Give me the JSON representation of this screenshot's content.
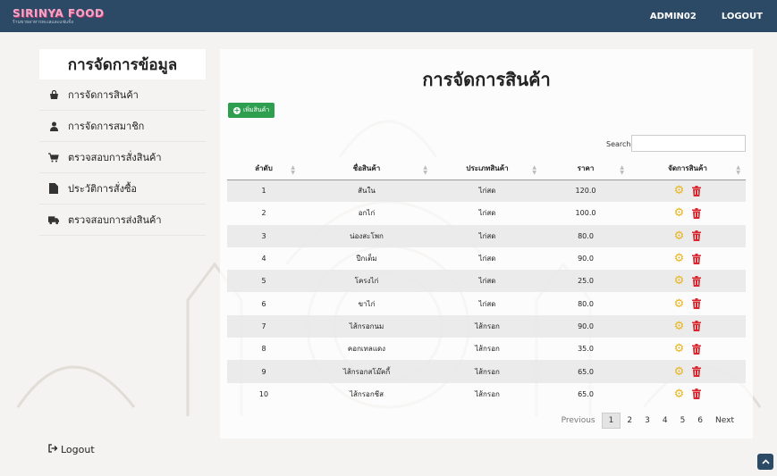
{
  "navbar": {
    "brand": "SIRINYA FOOD",
    "brand_sub": "ร้านขายอาหารทะเลและแช่แข็ง",
    "user": "ADMIN02",
    "logout": "LOGOUT"
  },
  "sidebar": {
    "title": "การจัดการข้อมูล",
    "items": [
      {
        "label": "การจัดการสินค้า",
        "icon": "bag-icon"
      },
      {
        "label": "การจัดการสมาชิก",
        "icon": "user-icon"
      },
      {
        "label": "ตรวจสอบการสั่งสินค้า",
        "icon": "cart-icon"
      },
      {
        "label": "ประวัติการสั่งซื้อ",
        "icon": "file-icon"
      },
      {
        "label": "ตรวจสอบการส่งสินค้า",
        "icon": "truck-icon"
      }
    ],
    "logout": "Logout"
  },
  "main": {
    "title": "การจัดการสินค้า",
    "add_button": "เพิ่มสินค้า",
    "search_label": "Search:",
    "search_value": "",
    "columns": [
      "ลำดับ",
      "ชื่อสินค้า",
      "ประเภทสินค้า",
      "ราคา",
      "จัดการสินค้า"
    ],
    "rows": [
      {
        "no": "1",
        "name": "สันใน",
        "type": "ไก่สด",
        "price": "120.0"
      },
      {
        "no": "2",
        "name": "อกไก่",
        "type": "ไก่สด",
        "price": "100.0"
      },
      {
        "no": "3",
        "name": "น่องสะโพก",
        "type": "ไก่สด",
        "price": "80.0"
      },
      {
        "no": "4",
        "name": "ปีกเต็ม",
        "type": "ไก่สด",
        "price": "90.0"
      },
      {
        "no": "5",
        "name": "โครงไก่",
        "type": "ไก่สด",
        "price": "25.0"
      },
      {
        "no": "6",
        "name": "ขาไก่",
        "type": "ไก่สด",
        "price": "80.0"
      },
      {
        "no": "7",
        "name": "ไส้กรอกนม",
        "type": "ไส้กรอก",
        "price": "90.0"
      },
      {
        "no": "8",
        "name": "คอกเทลแดง",
        "type": "ไส้กรอก",
        "price": "35.0"
      },
      {
        "no": "9",
        "name": "ไส้กรอกสโม๊คกี้",
        "type": "ไส้กรอก",
        "price": "65.0"
      },
      {
        "no": "10",
        "name": "ไส้กรอกชีส",
        "type": "ไส้กรอก",
        "price": "65.0"
      }
    ],
    "pagination": {
      "previous": "Previous",
      "pages": [
        "1",
        "2",
        "3",
        "4",
        "5",
        "6"
      ],
      "current": "1",
      "next": "Next"
    }
  },
  "colors": {
    "navbar": "#2c4a66",
    "add_button": "#2e9e4f",
    "edit_icon": "#e8b521",
    "delete_icon": "#d9252d"
  }
}
